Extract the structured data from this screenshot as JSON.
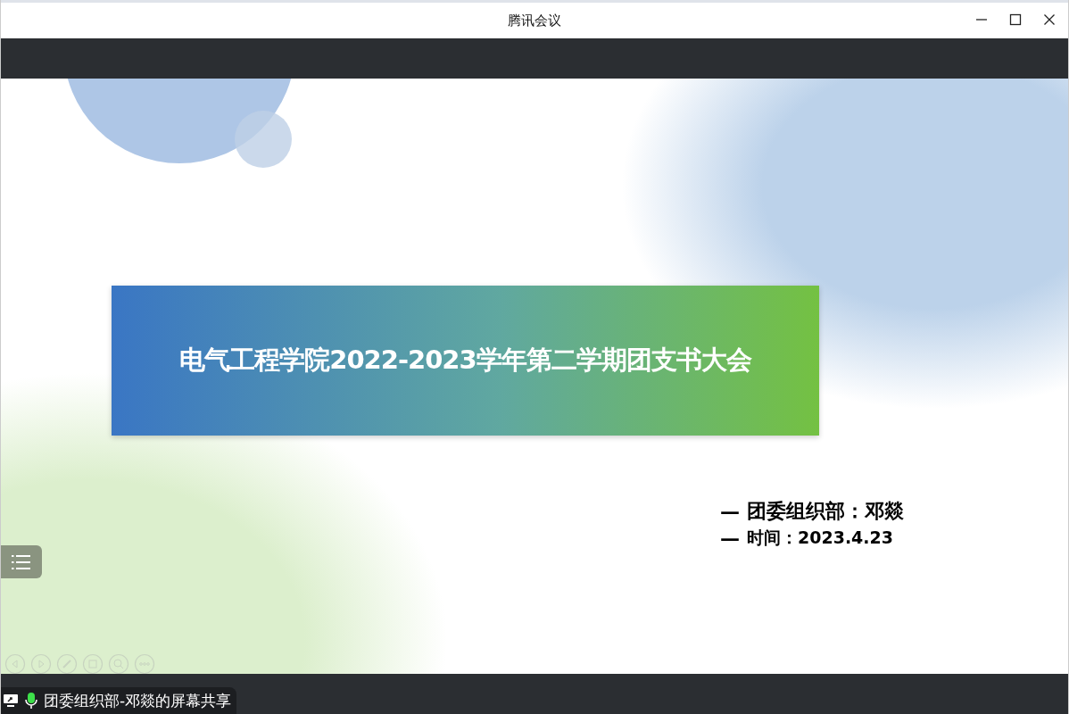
{
  "window": {
    "title": "腾讯会议"
  },
  "slide": {
    "title": "电气工程学院2022-2023学年第二学期团支书大会",
    "lines": [
      {
        "dash": "—",
        "text": "团委组织部：邓燚"
      },
      {
        "dash": "—",
        "text": "时间：2023.4.23"
      }
    ]
  },
  "share_bar": {
    "label": "团委组织部-邓燚的屏幕共享",
    "mic_on": true
  }
}
